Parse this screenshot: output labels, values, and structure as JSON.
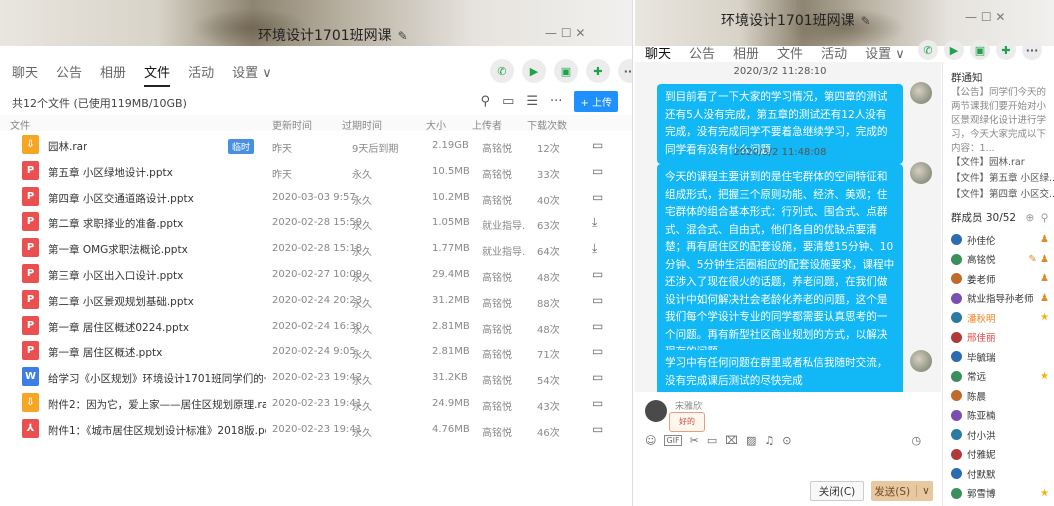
{
  "file_window": {
    "title": "环境设计1701班网课",
    "title_edit_icon": "pencil-icon",
    "controls": "—  ☐  ✕",
    "tabs": [
      {
        "label": "聊天"
      },
      {
        "label": "公告"
      },
      {
        "label": "相册"
      },
      {
        "label": "文件",
        "active": true
      },
      {
        "label": "活动"
      },
      {
        "label": "设置 ∨"
      }
    ],
    "top_icons": [
      "phone-icon",
      "video-icon",
      "screen-share-icon",
      "present-icon",
      "more-icon"
    ],
    "summary": "共12个文件 (已使用119MB/10GB)",
    "upload_label": "+ 上传",
    "columns": {
      "file": "文件",
      "modified": "更新时间",
      "expires": "过期时间",
      "size": "大小",
      "uploader": "上传者",
      "downloads": "下载次数"
    },
    "files": [
      {
        "icon": "rar",
        "name": "园林.rar",
        "badge": "临时",
        "modified": "昨天",
        "expires": "9天后到期",
        "size": "2.19GB",
        "uploader": "高铭悦",
        "downloads": "12次",
        "action": "folder"
      },
      {
        "icon": "ppt",
        "name": "第五章 小区绿地设计.pptx",
        "modified": "昨天",
        "expires": "永久",
        "size": "10.5MB",
        "uploader": "高铭悦",
        "downloads": "33次",
        "action": "folder"
      },
      {
        "icon": "ppt",
        "name": "第四章 小区交通道路设计.pptx",
        "modified": "2020-03-03 9:57",
        "expires": "永久",
        "size": "10.2MB",
        "uploader": "高铭悦",
        "downloads": "40次",
        "action": "folder"
      },
      {
        "icon": "ppt",
        "name": "第二章 求职择业的准备.pptx",
        "modified": "2020-02-28 15:59",
        "expires": "永久",
        "size": "1.05MB",
        "uploader": "就业指导...",
        "downloads": "63次",
        "action": "download"
      },
      {
        "icon": "ppt",
        "name": "第一章 OMG求职法概论.pptx",
        "modified": "2020-02-28 15:18",
        "expires": "永久",
        "size": "1.77MB",
        "uploader": "就业指导...",
        "downloads": "64次",
        "action": "download"
      },
      {
        "icon": "ppt",
        "name": "第三章 小区出入口设计.pptx",
        "modified": "2020-02-27 10:09",
        "expires": "永久",
        "size": "29.4MB",
        "uploader": "高铭悦",
        "downloads": "48次",
        "action": "folder"
      },
      {
        "icon": "ppt",
        "name": "第二章 小区景观规划基础.pptx",
        "modified": "2020-02-24 20:23",
        "expires": "永久",
        "size": "31.2MB",
        "uploader": "高铭悦",
        "downloads": "88次",
        "action": "folder"
      },
      {
        "icon": "ppt",
        "name": "第一章 居住区概述0224.pptx",
        "modified": "2020-02-24 16:30",
        "expires": "永久",
        "size": "2.81MB",
        "uploader": "高铭悦",
        "downloads": "48次",
        "action": "folder"
      },
      {
        "icon": "ppt",
        "name": "第一章 居住区概述.pptx",
        "modified": "2020-02-24 9:05",
        "expires": "永久",
        "size": "2.81MB",
        "uploader": "高铭悦",
        "downloads": "71次",
        "action": "folder"
      },
      {
        "icon": "doc",
        "name": "给学习《小区规划》环境设计1701班同学们的一封信.docx",
        "modified": "2020-02-23 19:42",
        "expires": "永久",
        "size": "31.2KB",
        "uploader": "高铭悦",
        "downloads": "54次",
        "action": "folder"
      },
      {
        "icon": "rar",
        "name": "附件2：因为它，爱上家——居住区规划原理.rar",
        "modified": "2020-02-23 19:41",
        "expires": "永久",
        "size": "24.9MB",
        "uploader": "高铭悦",
        "downloads": "43次",
        "action": "folder"
      },
      {
        "icon": "pdf",
        "name": "附件1：《城市居住区规划设计标准》2018版.pdf",
        "modified": "2020-02-23 19:41",
        "expires": "永久",
        "size": "4.76MB",
        "uploader": "高铭悦",
        "downloads": "46次",
        "action": "folder"
      }
    ]
  },
  "chat_window": {
    "title": "环境设计1701班网课",
    "controls": "—  ☐  ✕",
    "tabs": [
      {
        "label": "聊天",
        "active": true
      },
      {
        "label": "公告"
      },
      {
        "label": "相册"
      },
      {
        "label": "文件"
      },
      {
        "label": "活动"
      },
      {
        "label": "设置 ∨"
      }
    ],
    "messages": [
      {
        "time": "2020/3/2 11:28:10",
        "text": "到目前看了一下大家的学习情况，第四章的测试还有5人没有完成，第五章的测试还有12人没有完成，没有完成同学不要着急继续学习，完成的同学看有没有什么问题"
      },
      {
        "time": "2020/3/2 11:48:08",
        "text": "今天的课程主要讲到的是住宅群体的空间特征和组成形式，把握三个原则功能、经济、美观；住宅群体的组合基本形式：行列式、围合式、点群式、混合式、自由式，他们各自的优缺点要清楚；再有居住区的配套设施，要清楚15分钟、10分钟、5分钟生活圈相应的配套设施要求，课程中还涉入了现在很火的话题，养老问题，在我们做设计中如何解决社会老龄化养老的问题，这个是我们每个学设计专业的同学都需要认真思考的一个问题。再有新型社区商业规划的方式，以解决现存的问题。"
      },
      {
        "time": "",
        "text": "学习中有任何问题在群里或者私信我随时交流，没有完成课后测试的尽快完成"
      }
    ],
    "last_sender": "宋雅欣",
    "sticker_text": "好的",
    "input_icons": [
      "emoji-icon",
      "gif-icon",
      "scissors-icon",
      "folder-icon",
      "gift-icon",
      "image-icon",
      "bell-icon",
      "more-icon"
    ],
    "history_icon": "clock-icon",
    "close_label": "关闭(C)",
    "send_label": "发送(S)",
    "send_menu_icon": "chevron-down-icon",
    "sidebar": {
      "notice_title": "群通知",
      "notice_text": "【公告】同学们今天的两节课我们要开始对小区景观绿化设计进行学习，今天大家完成以下内容：1...",
      "file_links": [
        "【文件】园林.rar",
        "【文件】第五章 小区绿...",
        "【文件】第四章 小区交..."
      ],
      "members_title": "群成员 30/52",
      "members": [
        {
          "name": "孙佳伦",
          "color": "normal",
          "role": "admin"
        },
        {
          "name": "高铭悦",
          "color": "normal",
          "role": "owner"
        },
        {
          "name": "姜老师",
          "color": "normal",
          "role": "admin"
        },
        {
          "name": "就业指导孙老师",
          "color": "normal",
          "role": "admin"
        },
        {
          "name": "潘秋明",
          "color": "orange",
          "role": "star"
        },
        {
          "name": "邢佳丽",
          "color": "red",
          "role": ""
        },
        {
          "name": "毕毓瑞",
          "color": "normal",
          "role": ""
        },
        {
          "name": "常远",
          "color": "normal",
          "role": "star"
        },
        {
          "name": "陈晨",
          "color": "normal",
          "role": ""
        },
        {
          "name": "陈亚楠",
          "color": "normal",
          "role": ""
        },
        {
          "name": "付小洪",
          "color": "normal",
          "role": ""
        },
        {
          "name": "付雅妮",
          "color": "normal",
          "role": ""
        },
        {
          "name": "付默默",
          "color": "normal",
          "role": ""
        },
        {
          "name": "郭雪博",
          "color": "normal",
          "role": "star"
        }
      ]
    }
  }
}
